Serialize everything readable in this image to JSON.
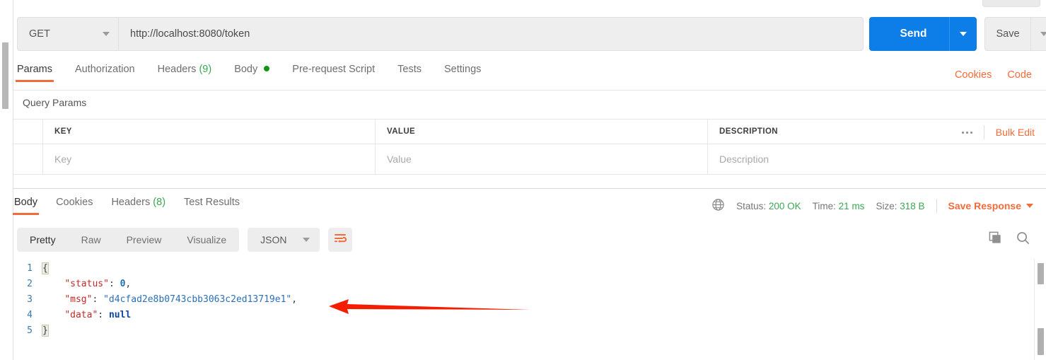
{
  "request": {
    "method": "GET",
    "url": "http://localhost:8080/token",
    "send_label": "Send",
    "save_label": "Save",
    "tabs": [
      {
        "label": "Params",
        "count": "",
        "dot": false,
        "active": true
      },
      {
        "label": "Authorization",
        "count": "",
        "dot": false,
        "active": false
      },
      {
        "label": "Headers",
        "count": "(9)",
        "dot": false,
        "active": false
      },
      {
        "label": "Body",
        "count": "",
        "dot": true,
        "active": false
      },
      {
        "label": "Pre-request Script",
        "count": "",
        "dot": false,
        "active": false
      },
      {
        "label": "Tests",
        "count": "",
        "dot": false,
        "active": false
      },
      {
        "label": "Settings",
        "count": "",
        "dot": false,
        "active": false
      }
    ],
    "header_links": [
      {
        "label": "Cookies"
      },
      {
        "label": "Code"
      }
    ]
  },
  "query_params": {
    "title": "Query Params",
    "columns": [
      "KEY",
      "VALUE",
      "DESCRIPTION"
    ],
    "rows": [
      {
        "key": "Key",
        "value": "Value",
        "description": "Description"
      }
    ],
    "bulk_edit_label": "Bulk Edit"
  },
  "response": {
    "tabs": [
      {
        "label": "Body",
        "count": "",
        "active": true
      },
      {
        "label": "Cookies",
        "count": "",
        "active": false
      },
      {
        "label": "Headers",
        "count": "(8)",
        "active": false
      },
      {
        "label": "Test Results",
        "count": "",
        "active": false
      }
    ],
    "meta": {
      "status_label": "Status:",
      "status_value": "200 OK",
      "time_label": "Time:",
      "time_value": "21 ms",
      "size_label": "Size:",
      "size_value": "318 B",
      "save_response_label": "Save Response"
    },
    "toolbar": {
      "views": [
        {
          "label": "Pretty",
          "active": true
        },
        {
          "label": "Raw",
          "active": false
        },
        {
          "label": "Preview",
          "active": false
        },
        {
          "label": "Visualize",
          "active": false
        }
      ],
      "format": "JSON"
    },
    "body_lines": [
      {
        "num": "1",
        "indent": 0,
        "tokens": [
          {
            "t": "brace",
            "v": "{"
          }
        ]
      },
      {
        "num": "2",
        "indent": 1,
        "tokens": [
          {
            "t": "key",
            "v": "\"status\""
          },
          {
            "t": "punct",
            "v": ": "
          },
          {
            "t": "num",
            "v": "0"
          },
          {
            "t": "punct",
            "v": ","
          }
        ]
      },
      {
        "num": "3",
        "indent": 1,
        "tokens": [
          {
            "t": "key",
            "v": "\"msg\""
          },
          {
            "t": "punct",
            "v": ": "
          },
          {
            "t": "str",
            "v": "\"d4cfad2e8b0743cbb3063c2ed13719e1\""
          },
          {
            "t": "punct",
            "v": ","
          }
        ]
      },
      {
        "num": "4",
        "indent": 1,
        "tokens": [
          {
            "t": "key",
            "v": "\"data\""
          },
          {
            "t": "punct",
            "v": ": "
          },
          {
            "t": "null",
            "v": "null"
          }
        ]
      },
      {
        "num": "5",
        "indent": 0,
        "tokens": [
          {
            "t": "brace",
            "v": "}"
          }
        ]
      }
    ]
  },
  "annotation": {
    "arrow_color": "#f51d00"
  },
  "colors": {
    "accent_orange": "#f26b3a",
    "send_blue": "#0d7ee8",
    "status_green": "#3aa655"
  }
}
